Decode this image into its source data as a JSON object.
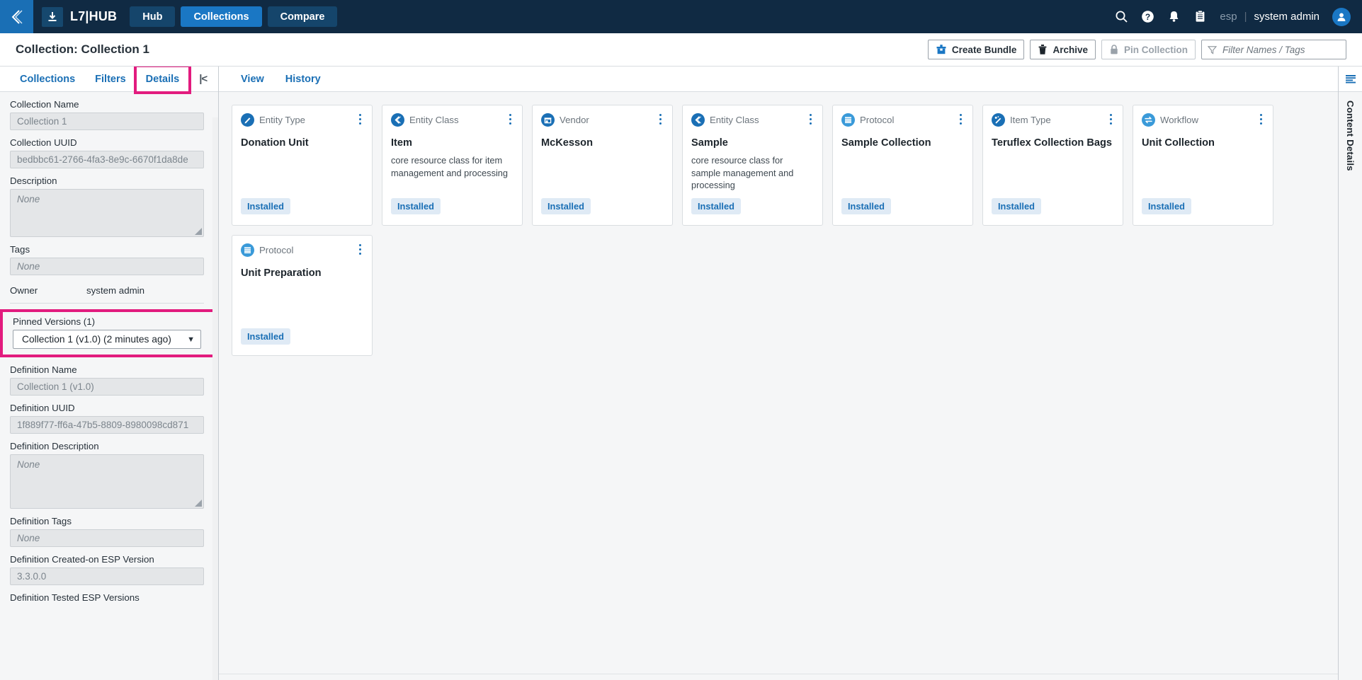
{
  "topnav": {
    "logo_icon": "double-chevron-left-icon",
    "download_icon": "download-icon",
    "brand": "L7|HUB",
    "tabs": [
      {
        "label": "Hub",
        "active": false
      },
      {
        "label": "Collections",
        "active": true
      },
      {
        "label": "Compare",
        "active": false
      }
    ],
    "icons": [
      {
        "name": "search-icon"
      },
      {
        "name": "help-icon"
      },
      {
        "name": "notification-bell-icon"
      },
      {
        "name": "clipboard-icon"
      }
    ],
    "tenant": "esp",
    "separator": "|",
    "user": "system admin",
    "avatar_icon": "user-avatar-icon",
    "bg_color": "#102a43",
    "accent_color": "#1a77c4"
  },
  "subheader": {
    "title": "Collection: Collection 1",
    "buttons": [
      {
        "label": "Create Bundle",
        "icon": "bundle-box-icon",
        "disabled": false
      },
      {
        "label": "Archive",
        "icon": "trash-icon",
        "disabled": false
      },
      {
        "label": "Pin Collection",
        "icon": "lock-icon",
        "disabled": true
      }
    ],
    "filter": {
      "icon": "funnel-icon",
      "placeholder": "Filter Names / Tags",
      "value": ""
    }
  },
  "sidebar": {
    "tabs": [
      {
        "label": "Collections",
        "highlighted": false
      },
      {
        "label": "Filters",
        "highlighted": false
      },
      {
        "label": "Details",
        "highlighted": true
      }
    ],
    "collapse_icon": "collapse-panel-icon",
    "collapse_glyph": "|<",
    "fields": {
      "collection_name": {
        "label": "Collection Name",
        "value": "Collection 1"
      },
      "collection_uuid": {
        "label": "Collection UUID",
        "value": "bedbbc61-2766-4fa3-8e9c-6670f1da8de"
      },
      "description": {
        "label": "Description",
        "value": "None"
      },
      "tags": {
        "label": "Tags",
        "value": "None"
      },
      "owner": {
        "label": "Owner",
        "value": "system admin"
      },
      "pinned_versions": {
        "label": "Pinned Versions (1)",
        "selected": "Collection 1 (v1.0) (2 minutes ago)",
        "chevron": "▼"
      },
      "definition_name": {
        "label": "Definition Name",
        "value": "Collection 1 (v1.0)"
      },
      "definition_uuid": {
        "label": "Definition UUID",
        "value": "1f889f77-ff6a-47b5-8809-8980098cd871"
      },
      "definition_description": {
        "label": "Definition Description",
        "value": "None"
      },
      "definition_tags": {
        "label": "Definition Tags",
        "value": "None"
      },
      "definition_created_esp": {
        "label": "Definition Created-on ESP Version",
        "value": "3.3.0.0"
      },
      "definition_tested_esp": {
        "label": "Definition Tested ESP Versions"
      }
    },
    "highlight_color": "#e21b7e"
  },
  "main": {
    "tabs": [
      {
        "label": "View",
        "active": true
      },
      {
        "label": "History",
        "active": false
      }
    ],
    "cards": [
      {
        "type": "Entity Type",
        "icon": "pencil-circle-icon",
        "title": "Donation Unit",
        "desc": "",
        "badge": "Installed"
      },
      {
        "type": "Entity Class",
        "icon": "chevron-circle-icon",
        "title": "Item",
        "desc": "core resource class for item management and processing",
        "badge": "Installed"
      },
      {
        "type": "Vendor",
        "icon": "store-circle-icon",
        "title": "McKesson",
        "desc": "",
        "badge": "Installed"
      },
      {
        "type": "Entity Class",
        "icon": "chevron-circle-icon",
        "title": "Sample",
        "desc": "core resource class for sample management and processing",
        "badge": "Installed"
      },
      {
        "type": "Protocol",
        "icon": "list-circle-icon",
        "title": "Sample Collection",
        "desc": "",
        "badge": "Installed"
      },
      {
        "type": "Item Type",
        "icon": "wand-circle-icon",
        "title": "Teruflex Collection Bags",
        "desc": "",
        "badge": "Installed"
      },
      {
        "type": "Workflow",
        "icon": "sync-circle-icon",
        "title": "Unit Collection",
        "desc": "",
        "badge": "Installed"
      },
      {
        "type": "Protocol",
        "icon": "list-circle-icon",
        "title": "Unit Preparation",
        "desc": "",
        "badge": "Installed"
      }
    ],
    "badge_bg": "#dfeaf5",
    "badge_color": "#1a6fb5"
  },
  "right_rail": {
    "icon": "content-details-icon",
    "label": "Content Details"
  }
}
